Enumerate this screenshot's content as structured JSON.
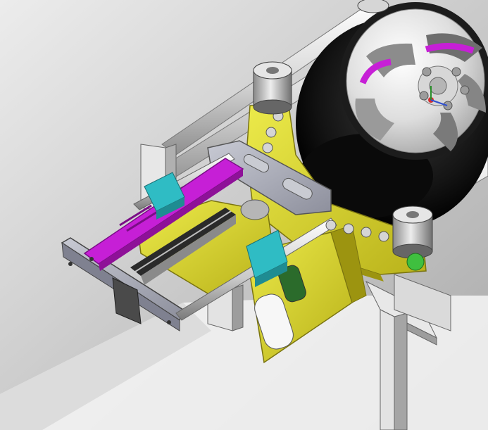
{
  "scene": {
    "colors": {
      "background_light": "#ececec",
      "background_dark": "#a9a9a9",
      "yellow_part": "#d4cf22",
      "yellow_shadow": "#9c9410",
      "magenta_part": "#c61fd6",
      "cyan_block": "#2fbcc4",
      "steel_gray": "#a6a8b4",
      "rail_white": "#e9e9e9",
      "tire_black": "#111111",
      "rim_silver": "#dcdcdc"
    },
    "icons": [
      "wheel-icon",
      "roller-icon",
      "bolt-icon"
    ]
  }
}
